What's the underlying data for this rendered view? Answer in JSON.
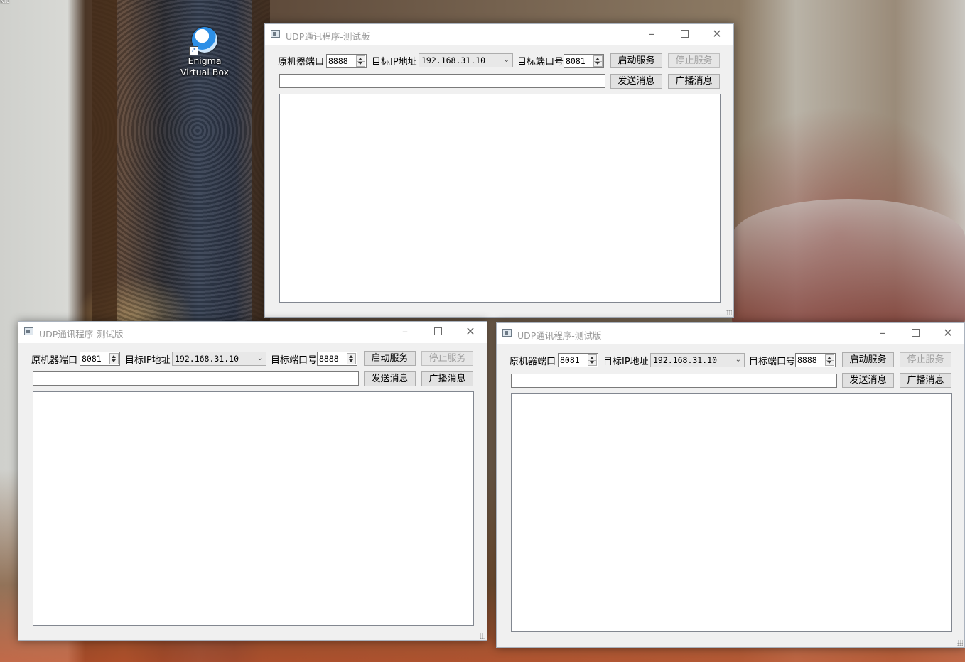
{
  "desktop": {
    "corner_text": "kit",
    "icon": {
      "name": "enigma-virtual-box-icon",
      "label_line1": "Enigma",
      "label_line2": "Virtual Box"
    }
  },
  "windows": [
    {
      "title": "UDP通讯程序-测试版",
      "labels": {
        "local_port": "原机器端口",
        "target_ip": "目标IP地址",
        "target_port": "目标端口号"
      },
      "local_port_value": "8888",
      "target_ip_value": "192.168.31.10",
      "target_port_value": "8081",
      "buttons": {
        "start": "启动服务",
        "stop": "停止服务",
        "send": "发送消息",
        "broadcast": "广播消息"
      },
      "stop_disabled": true,
      "message_value": "",
      "log_text": ""
    },
    {
      "title": "UDP通讯程序-测试版",
      "labels": {
        "local_port": "原机器端口",
        "target_ip": "目标IP地址",
        "target_port": "目标端口号"
      },
      "local_port_value": "8081",
      "target_ip_value": "192.168.31.10",
      "target_port_value": "8888",
      "buttons": {
        "start": "启动服务",
        "stop": "停止服务",
        "send": "发送消息",
        "broadcast": "广播消息"
      },
      "stop_disabled": true,
      "message_value": "",
      "log_text": ""
    },
    {
      "title": "UDP通讯程序-测试版",
      "labels": {
        "local_port": "原机器端口",
        "target_ip": "目标IP地址",
        "target_port": "目标端口号"
      },
      "local_port_value": "8081",
      "target_ip_value": "192.168.31.10",
      "target_port_value": "8888",
      "buttons": {
        "start": "启动服务",
        "stop": "停止服务",
        "send": "发送消息",
        "broadcast": "广播消息"
      },
      "stop_disabled": true,
      "message_value": "",
      "log_text": ""
    }
  ],
  "titlebar_icons": {
    "minimize": "minimize-icon",
    "maximize": "maximize-icon",
    "close": "close-icon"
  }
}
